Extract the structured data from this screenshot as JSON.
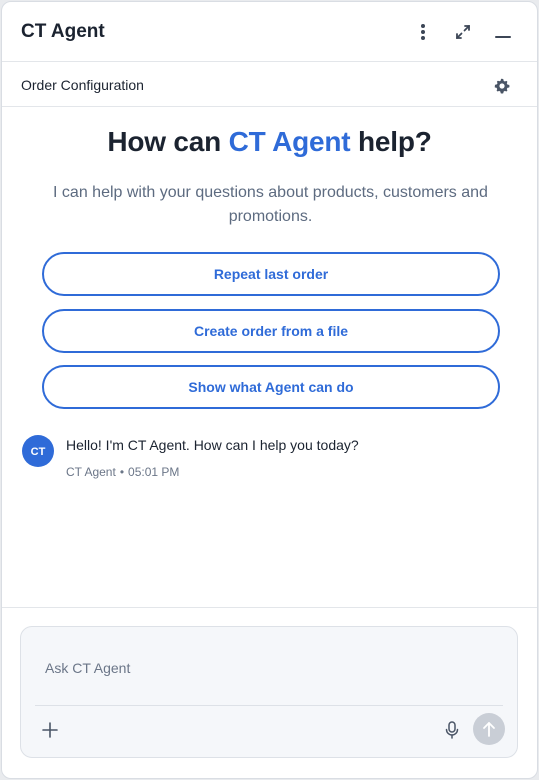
{
  "header": {
    "title": "CT Agent",
    "menu_icon": "more-vertical-icon",
    "expand_icon": "expand-icon",
    "minimize_icon": "minimize-icon"
  },
  "subbar": {
    "title": "Order Configuration",
    "settings_icon": "gear-icon"
  },
  "hero": {
    "title_prefix": "How can ",
    "title_accent": "CT Agent",
    "title_suffix": " help?",
    "subtitle": "I can help with your questions about products, customers and promotions."
  },
  "actions": [
    {
      "label": "Repeat last order"
    },
    {
      "label": "Create order from a file"
    },
    {
      "label": "Show what Agent can do"
    }
  ],
  "message": {
    "avatar_text": "CT",
    "text": "Hello! I'm CT Agent. How can I help you today?",
    "sender": "CT Agent",
    "separator": "•",
    "time": "05:01 PM"
  },
  "composer": {
    "placeholder": "Ask CT Agent",
    "value": "",
    "add_icon": "plus-icon",
    "mic_icon": "microphone-icon",
    "send_icon": "arrow-up-icon"
  },
  "colors": {
    "accent": "#2f6bd8",
    "text": "#1b2330",
    "muted": "#5d6b80",
    "send_disabled": "#c9ced6"
  }
}
